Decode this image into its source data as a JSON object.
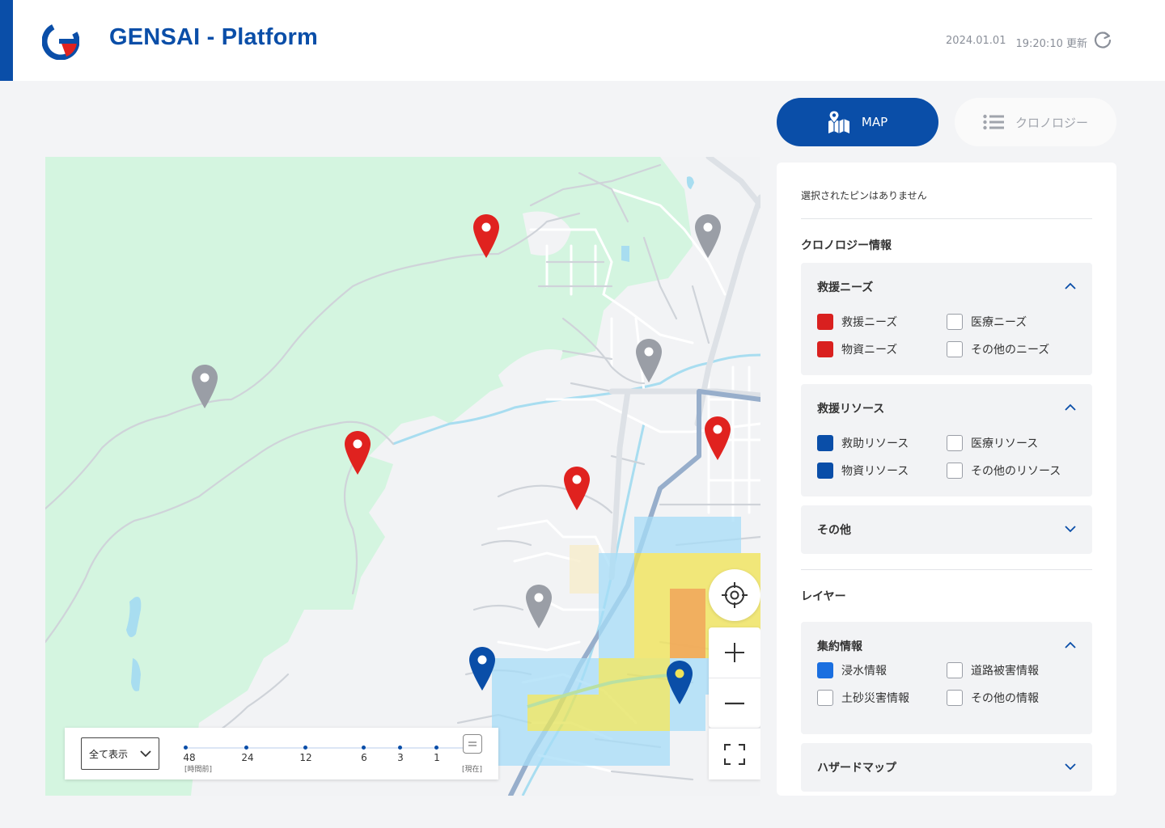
{
  "header": {
    "title": "GENSAI - Platform",
    "updated_date": "2024.01.01",
    "updated_time": "19:20:10 更新",
    "accent_color": "#0a4ea8",
    "logo_icon": "gensai-logo-icon",
    "refresh_icon": "refresh-icon"
  },
  "mode": {
    "map_label": "MAP",
    "chronology_label": "クロノロジー",
    "active": "MAP"
  },
  "map": {
    "pins": [
      {
        "color": "#e0221f",
        "kind": "need"
      },
      {
        "color": "#9a9ea6",
        "kind": "other"
      },
      {
        "color": "#9a9ea6",
        "kind": "other"
      },
      {
        "color": "#9a9ea6",
        "kind": "other"
      },
      {
        "color": "#e0221f",
        "kind": "need"
      },
      {
        "color": "#e0221f",
        "kind": "need"
      },
      {
        "color": "#e0221f",
        "kind": "need"
      },
      {
        "color": "#9a9ea6",
        "kind": "other"
      },
      {
        "color": "#0a4ea8",
        "kind": "resource"
      },
      {
        "color": "#0a4ea8",
        "kind": "resource-highlight"
      }
    ],
    "controls": {
      "locate_icon": "crosshair-icon",
      "zoom_in_icon": "plus-icon",
      "zoom_out_icon": "minus-icon",
      "fullscreen_icon": "fullscreen-icon"
    }
  },
  "timebar": {
    "select_value": "全て表示",
    "ticks": [
      "48",
      "24",
      "12",
      "6",
      "3",
      "1"
    ],
    "start_sub": "[時間前]",
    "end_sub": "[現在]"
  },
  "panel": {
    "no_pin_text": "選択されたピンはありません",
    "chronology_title": "クロノロジー情報",
    "cards": {
      "needs": {
        "title": "救援ニーズ",
        "expanded": true,
        "items": [
          {
            "label": "救援ニーズ",
            "checked": true,
            "color": "#d9201f"
          },
          {
            "label": "医療ニーズ",
            "checked": false
          },
          {
            "label": "物資ニーズ",
            "checked": true,
            "color": "#d9201f"
          },
          {
            "label": "その他のニーズ",
            "checked": false
          }
        ]
      },
      "resources": {
        "title": "救援リソース",
        "expanded": true,
        "items": [
          {
            "label": "救助リソース",
            "checked": true,
            "color": "#0a4ea8"
          },
          {
            "label": "医療リソース",
            "checked": false
          },
          {
            "label": "物資リソース",
            "checked": true,
            "color": "#0a4ea8"
          },
          {
            "label": "その他のリソース",
            "checked": false
          }
        ]
      },
      "other": {
        "title": "その他",
        "expanded": false
      }
    },
    "layer_title": "レイヤー",
    "layer_cards": {
      "aggregate": {
        "title": "集約情報",
        "expanded": true,
        "items": [
          {
            "label": "浸水情報",
            "checked": true,
            "color": "#1a6fe0"
          },
          {
            "label": "道路被害情報",
            "checked": false
          },
          {
            "label": "土砂災害情報",
            "checked": false
          },
          {
            "label": "その他の情報",
            "checked": false
          }
        ]
      },
      "hazard": {
        "title": "ハザードマップ",
        "expanded": false
      }
    }
  }
}
